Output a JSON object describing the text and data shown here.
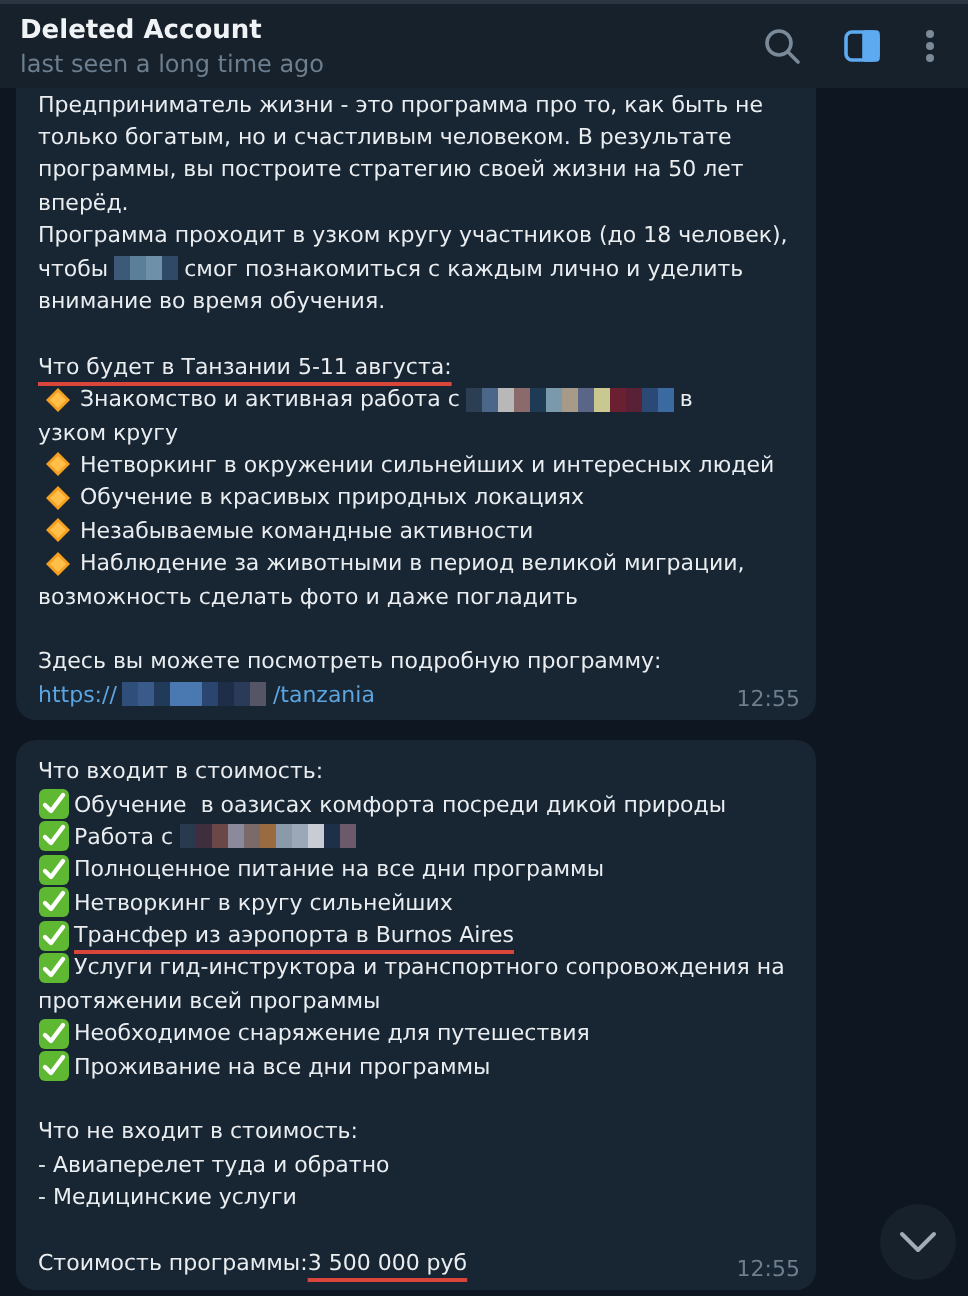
{
  "header": {
    "title": "Deleted Account",
    "status": "last seen a long time ago",
    "panel_open": true
  },
  "messages": [
    {
      "time": "12:55",
      "lines": [
        {
          "segments": [
            {
              "kind": "text",
              "text": "Предприниматель жизни - это программа про то, как быть не"
            }
          ]
        },
        {
          "segments": [
            {
              "kind": "text",
              "text": "только богатым, но и счастливым человеком. В результате"
            }
          ]
        },
        {
          "segments": [
            {
              "kind": "text",
              "text": "программы, вы построите стратегию своей жизни на 50 лет"
            }
          ]
        },
        {
          "segments": [
            {
              "kind": "text",
              "text": "вперёд."
            }
          ]
        },
        {
          "segments": [
            {
              "kind": "text",
              "text": "Программа проходит в узком кругу участников (до 18 человек),"
            }
          ]
        },
        {
          "segments": [
            {
              "kind": "text",
              "text": "чтобы"
            },
            {
              "kind": "blur"
            },
            {
              "kind": "text",
              "text": "смог познакомиться с каждым лично и уделить"
            }
          ]
        },
        {
          "segments": [
            {
              "kind": "text",
              "text": "внимание во время обучения."
            }
          ]
        },
        {
          "gap_before": true,
          "segments": [
            {
              "kind": "text",
              "text": "Что будет в Танзании 5-11 августа:",
              "underlined": true
            }
          ]
        },
        {
          "kind": "diamond",
          "segments": [
            {
              "kind": "text",
              "text": "Знакомство и активная работа с"
            },
            {
              "kind": "blur"
            },
            {
              "kind": "text",
              "text": "в"
            }
          ]
        },
        {
          "segments": [
            {
              "kind": "text",
              "text": "узком кругу"
            }
          ]
        },
        {
          "kind": "diamond",
          "segments": [
            {
              "kind": "text",
              "text": "Нетворкинг в окружении сильнейших и интересных людей"
            }
          ]
        },
        {
          "kind": "diamond",
          "segments": [
            {
              "kind": "text",
              "text": "Обучение в красивых природных локациях"
            }
          ]
        },
        {
          "kind": "diamond",
          "segments": [
            {
              "kind": "text",
              "text": "Незабываемые командные активности"
            }
          ]
        },
        {
          "kind": "diamond",
          "segments": [
            {
              "kind": "text",
              "text": "Наблюдение за животными в период великой миграции,"
            }
          ]
        },
        {
          "segments": [
            {
              "kind": "text",
              "text": "возможность сделать фото и даже погладить"
            }
          ]
        },
        {
          "gap_before": true,
          "segments": [
            {
              "kind": "text",
              "text": "Здесь вы можете посмотреть подробную программу:"
            }
          ]
        },
        {
          "segments": [
            {
              "kind": "link",
              "text": "https://"
            },
            {
              "kind": "blur"
            },
            {
              "kind": "link",
              "text": "/tanzania"
            }
          ]
        }
      ]
    },
    {
      "time": "12:55",
      "lines": [
        {
          "segments": [
            {
              "kind": "text",
              "text": "Что входит в стоимость:"
            }
          ]
        },
        {
          "kind": "check",
          "segments": [
            {
              "kind": "text",
              "text": "Обучение  в оазисах комфорта посреди дикой природы"
            }
          ]
        },
        {
          "kind": "check",
          "segments": [
            {
              "kind": "text",
              "text": "Работа с"
            },
            {
              "kind": "blur"
            }
          ]
        },
        {
          "kind": "check",
          "segments": [
            {
              "kind": "text",
              "text": "Полноценное питание на все дни программы"
            }
          ]
        },
        {
          "kind": "check",
          "segments": [
            {
              "kind": "text",
              "text": "Нетворкинг в кругу сильнейших"
            }
          ]
        },
        {
          "kind": "check",
          "segments": [
            {
              "kind": "text",
              "text": "Трансфер из аэропорта в Burnos Aires",
              "underlined": true
            }
          ]
        },
        {
          "kind": "check",
          "segments": [
            {
              "kind": "text",
              "text": "Услуги гид-инструктора и транспортного сопровождения на"
            }
          ]
        },
        {
          "segments": [
            {
              "kind": "text",
              "text": "протяжении всей программы"
            }
          ]
        },
        {
          "kind": "check",
          "segments": [
            {
              "kind": "text",
              "text": "Необходимое снаряжение для путешествия"
            }
          ]
        },
        {
          "kind": "check",
          "segments": [
            {
              "kind": "text",
              "text": "Проживание на все дни программы"
            }
          ]
        },
        {
          "gap_before": true,
          "segments": [
            {
              "kind": "text",
              "text": "Что не входит в стоимость:"
            }
          ]
        },
        {
          "segments": [
            {
              "kind": "text",
              "text": "- Авиаперелет туда и обратно"
            }
          ]
        },
        {
          "segments": [
            {
              "kind": "text",
              "text": "- Медицинские услуги"
            }
          ]
        },
        {
          "gap_before": true,
          "segments": [
            {
              "kind": "text",
              "text": "Стоимость программы:"
            },
            {
              "kind": "text",
              "text": "3 500 000 руб",
              "underlined": true
            }
          ]
        }
      ]
    }
  ]
}
